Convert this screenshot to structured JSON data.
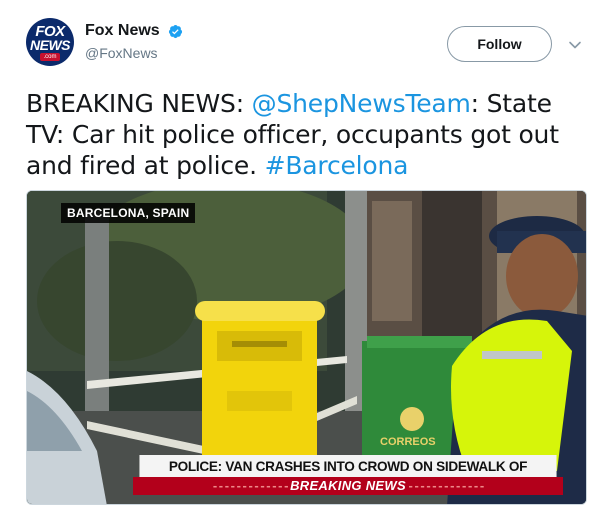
{
  "account": {
    "display_name": "Fox News",
    "handle": "@FoxNews",
    "verified": true,
    "avatar_logo": {
      "line1": "FOX",
      "line2": "NEWS",
      "line3": ".com"
    }
  },
  "follow_button": {
    "label": "Follow"
  },
  "tweet": {
    "prefix": "BREAKING NEWS: ",
    "mention": "@ShepNewsTeam",
    "body": ": State TV: Car hit police officer, occupants got out and fired at police. ",
    "hashtag": "#Barcelona"
  },
  "media": {
    "location_tag": "BARCELONA, SPAIN",
    "chyron": "POLICE: VAN CRASHES INTO CROWD ON SIDEWALK OF TOURIST AREA",
    "breaking_label": "BREAKING NEWS",
    "mailbox_brand": "CORREOS"
  },
  "icons": {
    "verified": "verified-badge-icon",
    "caret": "chevron-down-icon"
  },
  "colors": {
    "link": "#1b95e0",
    "verified": "#1da1f2",
    "breaking_red": "#b3001b",
    "mailbox_yellow": "#f2d40c",
    "hiviz_green": "#d6f50a"
  }
}
